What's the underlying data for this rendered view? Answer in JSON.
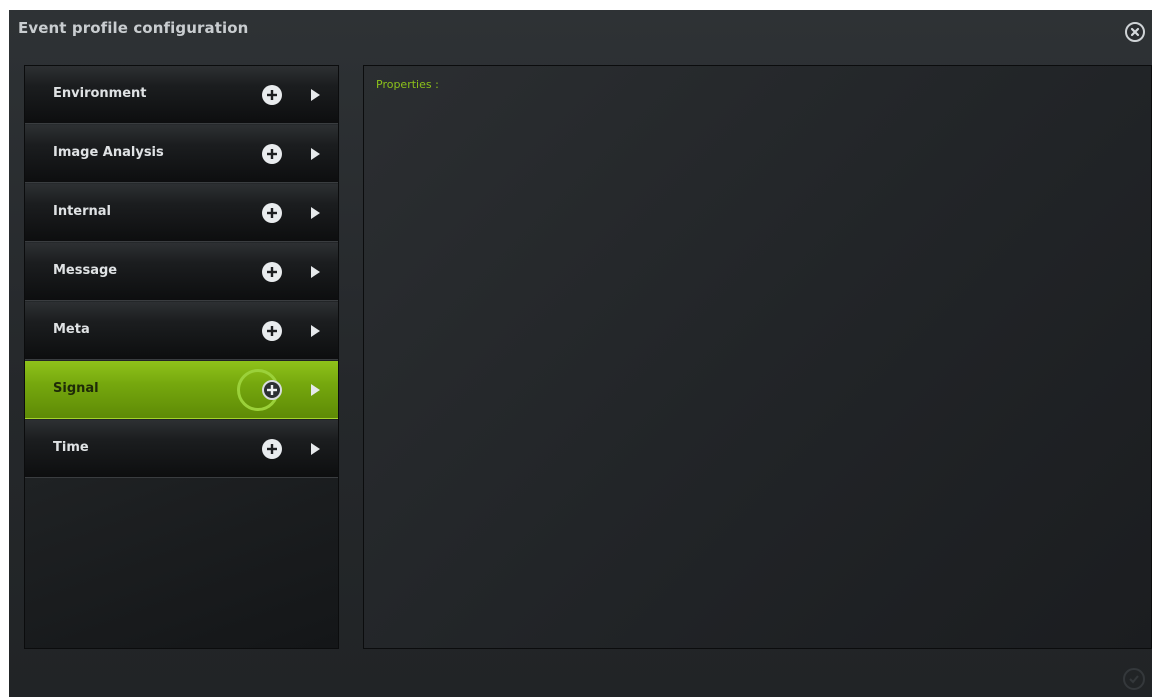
{
  "window": {
    "title": "Event profile configuration",
    "close_icon": "close-circle-icon",
    "confirm_icon": "check-circle-icon"
  },
  "categories": [
    {
      "label": "Environment",
      "selected": false
    },
    {
      "label": "Image Analysis",
      "selected": false
    },
    {
      "label": "Internal",
      "selected": false
    },
    {
      "label": "Message",
      "selected": false
    },
    {
      "label": "Meta",
      "selected": false
    },
    {
      "label": "Signal",
      "selected": true
    },
    {
      "label": "Time",
      "selected": false
    }
  ],
  "properties": {
    "label": "Properties :"
  },
  "colors": {
    "accent": "#8cc21a",
    "selected_bg": "#76a80e",
    "highlight_ring": "#9bd13a"
  }
}
